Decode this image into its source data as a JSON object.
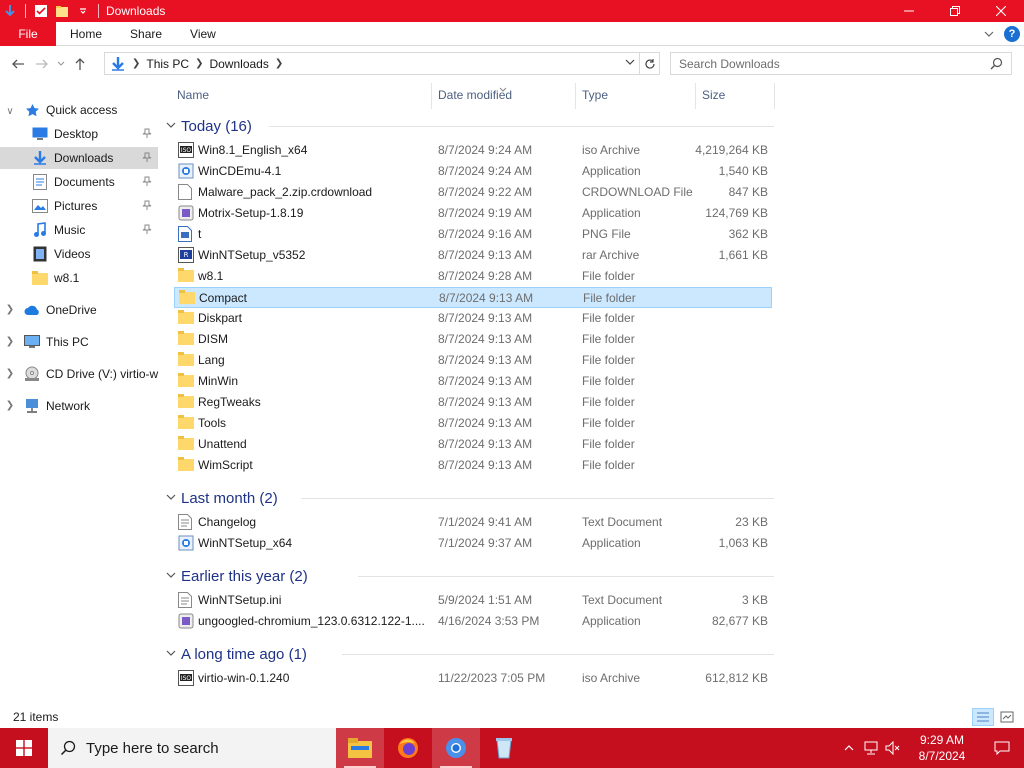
{
  "window": {
    "title": "Downloads",
    "colors": {
      "titlebar": "#e81123",
      "taskbar": "#c50f1f",
      "selection": "#cce8ff",
      "group_header": "#1e3287"
    }
  },
  "ribbon": {
    "tabs": [
      {
        "label": "File"
      },
      {
        "label": "Home"
      },
      {
        "label": "Share"
      },
      {
        "label": "View"
      }
    ]
  },
  "address": {
    "crumbs": [
      "This PC",
      "Downloads"
    ],
    "search_placeholder": "Search Downloads"
  },
  "nav": {
    "quick_access": "Quick access",
    "items": [
      {
        "label": "Desktop",
        "icon": "desktop-icon",
        "pinned": true
      },
      {
        "label": "Downloads",
        "icon": "download-icon",
        "pinned": true
      },
      {
        "label": "Documents",
        "icon": "documents-icon",
        "pinned": true
      },
      {
        "label": "Pictures",
        "icon": "pictures-icon",
        "pinned": true
      },
      {
        "label": "Music",
        "icon": "music-icon",
        "pinned": true
      },
      {
        "label": "Videos",
        "icon": "videos-icon",
        "pinned": false
      },
      {
        "label": "w8.1",
        "icon": "folder-icon",
        "pinned": false
      }
    ],
    "onedrive": "OneDrive",
    "thispc": "This PC",
    "cddrive": "CD Drive (V:) virtio-w",
    "network": "Network"
  },
  "columns": {
    "name": "Name",
    "date": "Date modified",
    "type": "Type",
    "size": "Size"
  },
  "groups": [
    {
      "label": "Today (16)",
      "files": [
        {
          "name": "Win8.1_English_x64",
          "date": "8/7/2024 9:24 AM",
          "type": "iso Archive",
          "size": "4,219,264 KB",
          "icon": "iso-icon"
        },
        {
          "name": "WinCDEmu-4.1",
          "date": "8/7/2024 9:24 AM",
          "type": "Application",
          "size": "1,540 KB",
          "icon": "app-icon"
        },
        {
          "name": "Malware_pack_2.zip.crdownload",
          "date": "8/7/2024 9:22 AM",
          "type": "CRDOWNLOAD File",
          "size": "847 KB",
          "icon": "file-icon"
        },
        {
          "name": "Motrix-Setup-1.8.19",
          "date": "8/7/2024 9:19 AM",
          "type": "Application",
          "size": "124,769 KB",
          "icon": "installer-icon"
        },
        {
          "name": "t",
          "date": "8/7/2024 9:16 AM",
          "type": "PNG File",
          "size": "362 KB",
          "icon": "image-file-icon"
        },
        {
          "name": "WinNTSetup_v5352",
          "date": "8/7/2024 9:13 AM",
          "type": "rar Archive",
          "size": "1,661 KB",
          "icon": "archive-icon"
        },
        {
          "name": "w8.1",
          "date": "8/7/2024 9:28 AM",
          "type": "File folder",
          "size": "",
          "icon": "folder-icon"
        },
        {
          "name": "Compact",
          "date": "8/7/2024 9:13 AM",
          "type": "File folder",
          "size": "",
          "icon": "folder-icon",
          "selected": true
        },
        {
          "name": "Diskpart",
          "date": "8/7/2024 9:13 AM",
          "type": "File folder",
          "size": "",
          "icon": "folder-icon"
        },
        {
          "name": "DISM",
          "date": "8/7/2024 9:13 AM",
          "type": "File folder",
          "size": "",
          "icon": "folder-icon"
        },
        {
          "name": "Lang",
          "date": "8/7/2024 9:13 AM",
          "type": "File folder",
          "size": "",
          "icon": "folder-icon"
        },
        {
          "name": "MinWin",
          "date": "8/7/2024 9:13 AM",
          "type": "File folder",
          "size": "",
          "icon": "folder-icon"
        },
        {
          "name": "RegTweaks",
          "date": "8/7/2024 9:13 AM",
          "type": "File folder",
          "size": "",
          "icon": "folder-icon"
        },
        {
          "name": "Tools",
          "date": "8/7/2024 9:13 AM",
          "type": "File folder",
          "size": "",
          "icon": "folder-icon"
        },
        {
          "name": "Unattend",
          "date": "8/7/2024 9:13 AM",
          "type": "File folder",
          "size": "",
          "icon": "folder-icon"
        },
        {
          "name": "WimScript",
          "date": "8/7/2024 9:13 AM",
          "type": "File folder",
          "size": "",
          "icon": "folder-icon"
        }
      ]
    },
    {
      "label": "Last month (2)",
      "files": [
        {
          "name": "Changelog",
          "date": "7/1/2024 9:41 AM",
          "type": "Text Document",
          "size": "23 KB",
          "icon": "text-file-icon"
        },
        {
          "name": "WinNTSetup_x64",
          "date": "7/1/2024 9:37 AM",
          "type": "Application",
          "size": "1,063 KB",
          "icon": "app-icon"
        }
      ]
    },
    {
      "label": "Earlier this year (2)",
      "files": [
        {
          "name": "WinNTSetup.ini",
          "date": "5/9/2024 1:51 AM",
          "type": "Text Document",
          "size": "3 KB",
          "icon": "text-file-icon"
        },
        {
          "name": "ungoogled-chromium_123.0.6312.122-1....",
          "date": "4/16/2024 3:53 PM",
          "type": "Application",
          "size": "82,677 KB",
          "icon": "installer-icon"
        }
      ]
    },
    {
      "label": "A long time ago (1)",
      "files": [
        {
          "name": "virtio-win-0.1.240",
          "date": "11/22/2023 7:05 PM",
          "type": "iso Archive",
          "size": "612,812 KB",
          "icon": "iso-icon"
        }
      ]
    }
  ],
  "status": {
    "items": "21 items"
  },
  "taskbar": {
    "search_placeholder": "Type here to search",
    "time": "9:29 AM",
    "date": "8/7/2024"
  }
}
